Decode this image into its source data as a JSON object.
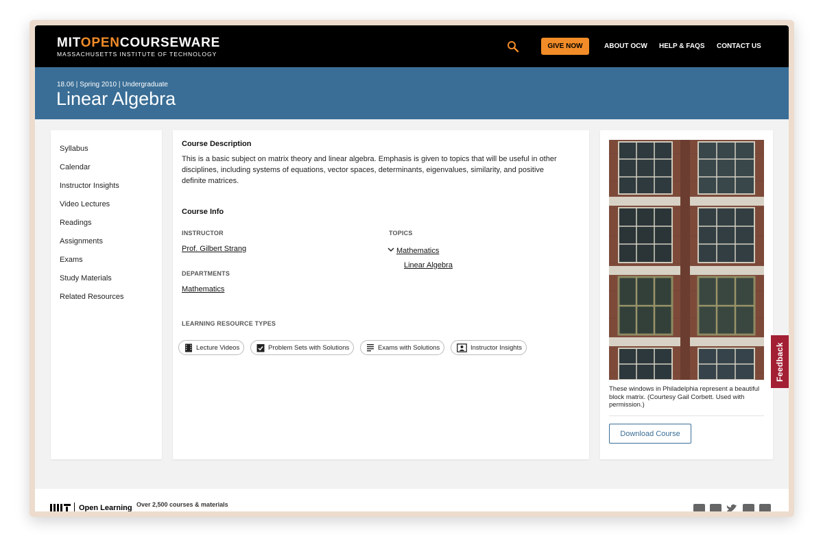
{
  "header": {
    "logo_part1": "MIT",
    "logo_part2": "OPEN",
    "logo_part3": "COURSEWARE",
    "logo_sub": "MASSACHUSETTS INSTITUTE OF TECHNOLOGY",
    "give_now": "GIVE NOW",
    "nav": [
      "ABOUT OCW",
      "HELP & FAQS",
      "CONTACT US"
    ],
    "accent_color": "#f28c28"
  },
  "course": {
    "meta": "18.06 | Spring 2010 | Undergraduate",
    "title": "Linear Algebra",
    "banner_color": "#3a6e96"
  },
  "sidebar": {
    "items": [
      "Syllabus",
      "Calendar",
      "Instructor Insights",
      "Video Lectures",
      "Readings",
      "Assignments",
      "Exams",
      "Study Materials",
      "Related Resources"
    ]
  },
  "main": {
    "desc_heading": "Course Description",
    "description": "This is a basic subject on matrix theory and linear algebra. Emphasis is given to topics that will be useful in other disciplines, including systems of equations, vector spaces, determinants, eigenvalues, similarity, and positive definite matrices.",
    "info_heading": "Course Info",
    "instructor_label": "INSTRUCTOR",
    "instructor": "Prof. Gilbert Strang",
    "departments_label": "DEPARTMENTS",
    "department": "Mathematics",
    "topics_label": "TOPICS",
    "topic_parent": "Mathematics",
    "topic_child": "Linear Algebra",
    "lrt_label": "LEARNING RESOURCE TYPES",
    "resource_types": [
      "Lecture Videos",
      "Problem Sets with Solutions",
      "Exams with Solutions",
      "Instructor Insights"
    ]
  },
  "aside": {
    "caption": "These windows in Philadelphia represent a beautiful block matrix. (Courtesy Gail Corbett. Used with permission.)",
    "download": "Download Course",
    "feedback": "Feedback",
    "feedback_color": "#a31f34"
  },
  "footer": {
    "open_learning": "Open Learning",
    "tagline": "Over 2,500 courses & materials",
    "social_icons": [
      "facebook-icon",
      "instagram-icon",
      "twitter-icon",
      "youtube-icon",
      "linkedin-icon"
    ]
  }
}
